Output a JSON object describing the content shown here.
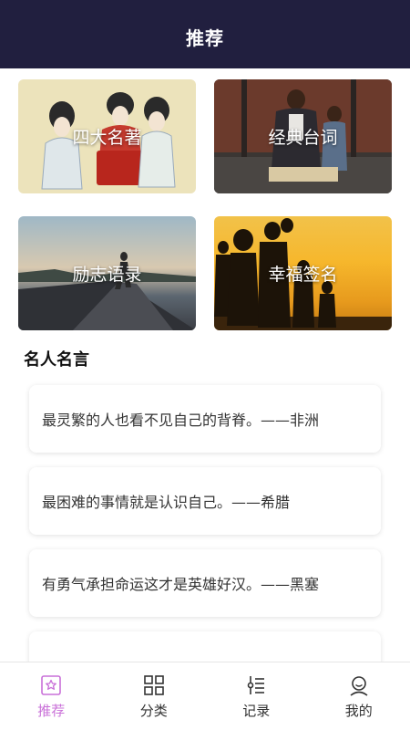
{
  "header": {
    "title": "推荐"
  },
  "categories": [
    {
      "label": "四大名著"
    },
    {
      "label": "经典台词"
    },
    {
      "label": "励志语录"
    },
    {
      "label": "幸福签名"
    }
  ],
  "section": {
    "title": "名人名言"
  },
  "quotes": [
    {
      "text": "最灵繁的人也看不见自己的背脊。——非洲"
    },
    {
      "text": "最困难的事情就是认识自己。——希腊"
    },
    {
      "text": "有勇气承担命运这才是英雄好汉。——黑塞"
    },
    {
      "text": ""
    }
  ],
  "tabbar": {
    "items": [
      {
        "label": "推荐",
        "icon": "star-bookmark-icon",
        "active": true
      },
      {
        "label": "分类",
        "icon": "grid-icon",
        "active": false
      },
      {
        "label": "记录",
        "icon": "list-icon",
        "active": false
      },
      {
        "label": "我的",
        "icon": "user-icon",
        "active": false
      }
    ],
    "active_color": "#c970d8"
  },
  "colors": {
    "header_bg": "#211f3f"
  }
}
